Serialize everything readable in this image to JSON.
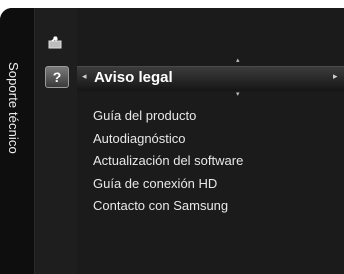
{
  "sidebar": {
    "title": "Soporte técnico"
  },
  "icons": {
    "top": "tools-icon",
    "current": "help-icon",
    "current_glyph": "?"
  },
  "selected": {
    "label": "Aviso legal",
    "left_arrow": "◂",
    "right_arrow": "▸",
    "up_arrow": "▴",
    "down_arrow": "▾"
  },
  "menu": {
    "items": [
      {
        "label": "Guía del producto"
      },
      {
        "label": "Autodiagnóstico"
      },
      {
        "label": "Actualización del software"
      },
      {
        "label": "Guía de conexión HD"
      },
      {
        "label": "Contacto con Samsung"
      }
    ]
  },
  "colors": {
    "panel": "#1b1b1b",
    "rail": "#0e0e0e",
    "text": "#e8e8e8",
    "selected_text": "#ffffff"
  }
}
